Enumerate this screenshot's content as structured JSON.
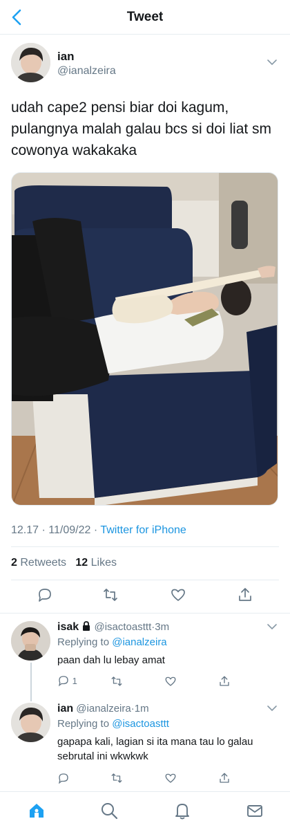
{
  "header": {
    "title": "Tweet",
    "back_icon": "chevron-left-icon"
  },
  "tweet": {
    "author_name": "ian",
    "author_handle": "@ianalzeira",
    "text": "udah cape2 pensi biar doi kagum, pulangnya malah galau bcs si doi liat sm cowonya wakakaka",
    "media_alt_icon": "photo",
    "time": "12.17",
    "date": "11/09/22",
    "separator": "·",
    "source": "Twitter for iPhone",
    "retweets_count": "2",
    "retweets_label": "Retweets",
    "likes_count": "12",
    "likes_label": "Likes"
  },
  "replies": [
    {
      "name": "isak",
      "lock_icon": "lock-icon",
      "handle": "@isactoasttt",
      "age": "3m",
      "replying_prefix": "Replying to",
      "replying_to": "@ianalzeira",
      "text": "paan dah lu lebay amat",
      "reply_count": "1"
    },
    {
      "name": "ian",
      "handle": "@ianalzeira",
      "age": "1m",
      "replying_prefix": "Replying to",
      "replying_to": "@isactoasttt",
      "text": "gapapa kali, lagian si ita mana tau lo galau sebrutal ini wkwkwk",
      "reply_count": ""
    }
  ],
  "tabbar": {
    "items": [
      "home-icon",
      "search-icon",
      "bell-icon",
      "mail-icon"
    ],
    "active": "home-icon"
  },
  "colors": {
    "accent": "#1da1f2",
    "text": "#14171a",
    "secondary": "#657786",
    "divider": "#e6ecf0"
  }
}
